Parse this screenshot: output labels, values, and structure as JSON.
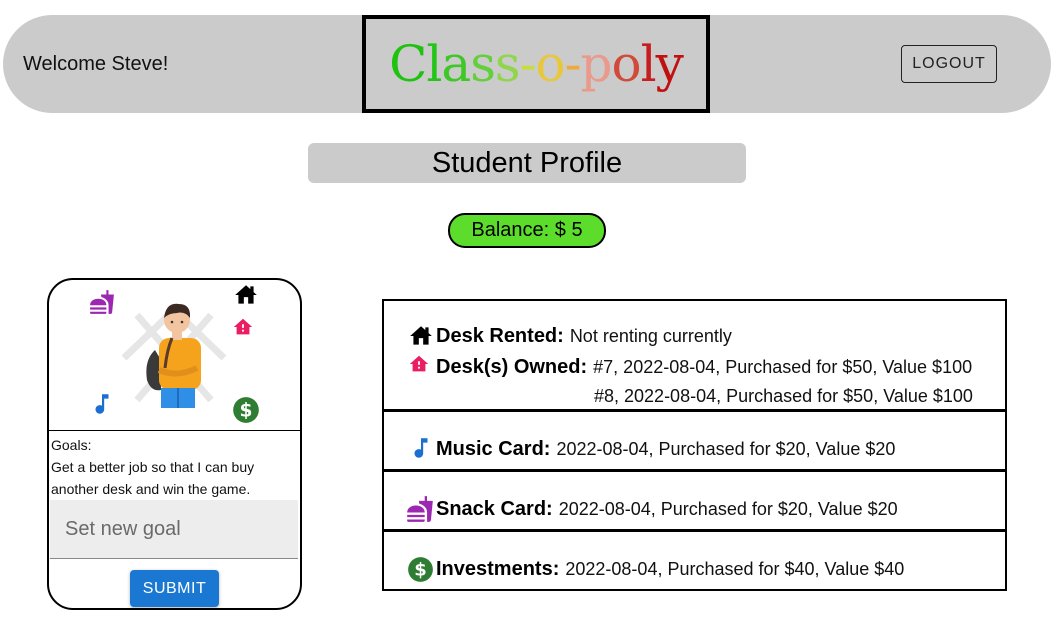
{
  "header": {
    "welcome": "Welcome Steve!",
    "logo_letters": [
      {
        "ch": "C",
        "color": "#1ec20f"
      },
      {
        "ch": "l",
        "color": "#24c418"
      },
      {
        "ch": "a",
        "color": "#3ec826"
      },
      {
        "ch": "s",
        "color": "#63cf3a"
      },
      {
        "ch": "s",
        "color": "#8fd64a"
      },
      {
        "ch": "-",
        "color": "#c7dd3a"
      },
      {
        "ch": "o",
        "color": "#e8c83a"
      },
      {
        "ch": "-",
        "color": "#f0a93a"
      },
      {
        "ch": "p",
        "color": "#e99a8a"
      },
      {
        "ch": "o",
        "color": "#d14a3a"
      },
      {
        "ch": "l",
        "color": "#c61e1e"
      },
      {
        "ch": "y",
        "color": "#c01010"
      }
    ],
    "logout_label": "LOGOUT"
  },
  "page_title": "Student Profile",
  "balance": "Balance: $ 5",
  "profile": {
    "goals_label": "Goals:",
    "goal_text": "Get a better job so that I can buy another desk and win the game.",
    "goal_placeholder": "Set new goal",
    "submit_label": "SUBMIT"
  },
  "assets": {
    "desk_rented": {
      "label": "Desk Rented:",
      "value": "Not renting currently"
    },
    "desks_owned": {
      "label": "Desk(s) Owned:",
      "values": [
        "#7, 2022-08-04, Purchased for $50, Value $100",
        "#8, 2022-08-04, Purchased for $50, Value $100"
      ]
    },
    "music": {
      "label": "Music Card:",
      "value": "2022-08-04, Purchased for $20, Value $20"
    },
    "snack": {
      "label": "Snack Card:",
      "value": "2022-08-04, Purchased for $20, Value $20"
    },
    "investments": {
      "label": "Investments:",
      "value": "2022-08-04, Purchased for $40, Value $40"
    }
  },
  "colors": {
    "header_bg": "#cbcbcb",
    "balance_bg": "#5cdd2c",
    "submit_bg": "#1a78d2",
    "music_icon": "#1a6fd1",
    "snack_icon": "#9c27b0",
    "owned_icon": "#e91e63",
    "money_icon": "#2e7d32"
  },
  "icons": [
    "house-icon",
    "house-pink-icon",
    "music-note-icon",
    "fastfood-icon",
    "dollar-circle-icon",
    "student-avatar"
  ]
}
